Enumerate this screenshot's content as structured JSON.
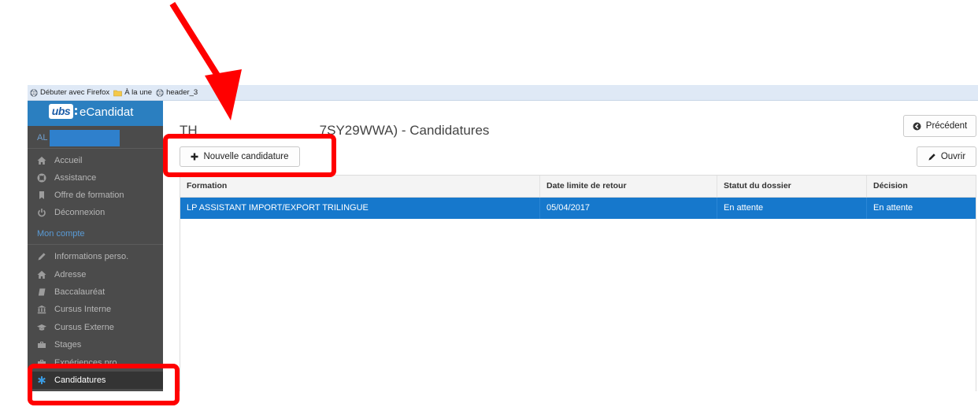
{
  "browser": {
    "bookmarks": [
      {
        "icon": "globe-icon",
        "label": "Débuter avec Firefox"
      },
      {
        "icon": "folder-icon",
        "label": "À la une"
      },
      {
        "icon": "globe-icon",
        "label": "header_3"
      }
    ]
  },
  "sidebar": {
    "brand": {
      "logo": "ubs",
      "name": "eCandidat"
    },
    "user_initials": "AL",
    "main_items": [
      {
        "icon": "home-icon",
        "label": "Accueil"
      },
      {
        "icon": "lifebuoy-icon",
        "label": "Assistance"
      },
      {
        "icon": "bookmark-icon",
        "label": "Offre de formation"
      },
      {
        "icon": "power-icon",
        "label": "Déconnexion"
      }
    ],
    "section_label": "Mon compte",
    "account_items": [
      {
        "icon": "pencil-icon",
        "label": "Informations perso."
      },
      {
        "icon": "home-icon",
        "label": "Adresse"
      },
      {
        "icon": "book-icon",
        "label": "Baccalauréat"
      },
      {
        "icon": "university-icon",
        "label": "Cursus Interne"
      },
      {
        "icon": "graduation-cap-icon",
        "label": "Cursus Externe"
      },
      {
        "icon": "briefcase-icon",
        "label": "Stages"
      },
      {
        "icon": "briefcase-icon",
        "label": "Expériences pro"
      },
      {
        "icon": "asterisk-icon",
        "label": "Candidatures",
        "active": true
      }
    ]
  },
  "page": {
    "title_prefix": "TH",
    "title_suffix": "7SY29WWA) - Candidatures",
    "back_button": "Précédent",
    "new_button": "Nouvelle candidature",
    "open_button": "Ouvrir"
  },
  "table": {
    "columns": [
      "Formation",
      "Date limite de retour",
      "Statut du dossier",
      "Décision"
    ],
    "rows": [
      {
        "formation": "LP ASSISTANT IMPORT/EXPORT TRILINGUE",
        "date": "05/04/2017",
        "statut": "En attente",
        "decision": "En attente",
        "selected": true
      }
    ]
  },
  "colors": {
    "brand": "#2b7fc0",
    "sidebar": "#4b4b4b",
    "selected_row": "#1678cc",
    "annotation": "#ff0000"
  }
}
